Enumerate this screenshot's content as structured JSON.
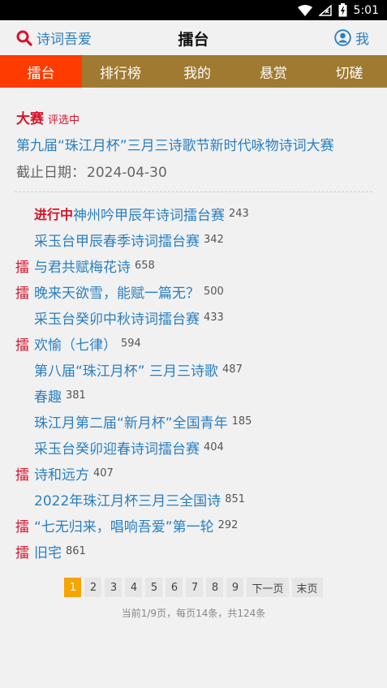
{
  "statusbar": {
    "time": "5:01"
  },
  "header": {
    "search_label": "诗词吾爱",
    "title": "擂台",
    "me_label": "我"
  },
  "tabs": [
    {
      "label": "擂台",
      "active": true
    },
    {
      "label": "排行榜"
    },
    {
      "label": "我的"
    },
    {
      "label": "悬赏"
    },
    {
      "label": "切磋"
    }
  ],
  "contest": {
    "tag": "大赛",
    "status": "评选中",
    "title": "第九届“珠江月杯”三月三诗歌节新时代咏物诗词大赛",
    "deadline_label": "截止日期：",
    "deadline_value": "2024-04-30"
  },
  "list": [
    {
      "mark": "",
      "progress": "进行中",
      "name": "神州吟甲辰年诗词擂台赛",
      "count": "243"
    },
    {
      "mark": "",
      "progress": "",
      "name": "采玉台甲辰春季诗词擂台赛",
      "count": "342"
    },
    {
      "mark": "擂",
      "progress": "",
      "name": "与君共赋梅花诗",
      "count": "658"
    },
    {
      "mark": "擂",
      "progress": "",
      "name": "晚来天欲雪，能赋一篇无？",
      "count": "500"
    },
    {
      "mark": "",
      "progress": "",
      "name": "采玉台癸卯中秋诗词擂台赛",
      "count": "433"
    },
    {
      "mark": "擂",
      "progress": "",
      "name": "欢愉（七律）",
      "count": "594"
    },
    {
      "mark": "",
      "progress": "",
      "name": "第八届“珠江月杯” 三月三诗歌",
      "count": "487"
    },
    {
      "mark": "",
      "progress": "",
      "name": "春趣",
      "count": "381"
    },
    {
      "mark": "",
      "progress": "",
      "name": "珠江月第二届“新月杯”全国青年",
      "count": "185"
    },
    {
      "mark": "",
      "progress": "",
      "name": "采玉台癸卯迎春诗词擂台赛",
      "count": "404"
    },
    {
      "mark": "擂",
      "progress": "",
      "name": "诗和远方",
      "count": "407"
    },
    {
      "mark": "",
      "progress": "",
      "name": "2022年珠江月杯三月三全国诗",
      "count": "851"
    },
    {
      "mark": "擂",
      "progress": "",
      "name": "“七无归来，唱响吾爱”第一轮",
      "count": "292"
    },
    {
      "mark": "擂",
      "progress": "",
      "name": "旧宅",
      "count": "861"
    }
  ],
  "pager": {
    "pages": [
      "1",
      "2",
      "3",
      "4",
      "5",
      "6",
      "7",
      "8",
      "9"
    ],
    "current": "1",
    "next_label": "下一页",
    "last_label": "末页",
    "info": "当前1/9页，每页14条，共124条"
  },
  "colors": {
    "tab_bar": "#a07a31",
    "tab_active": "#fe3b00",
    "link_blue": "#2a7fc1",
    "accent_red": "#d5142b",
    "pager_active": "#f6a400"
  }
}
